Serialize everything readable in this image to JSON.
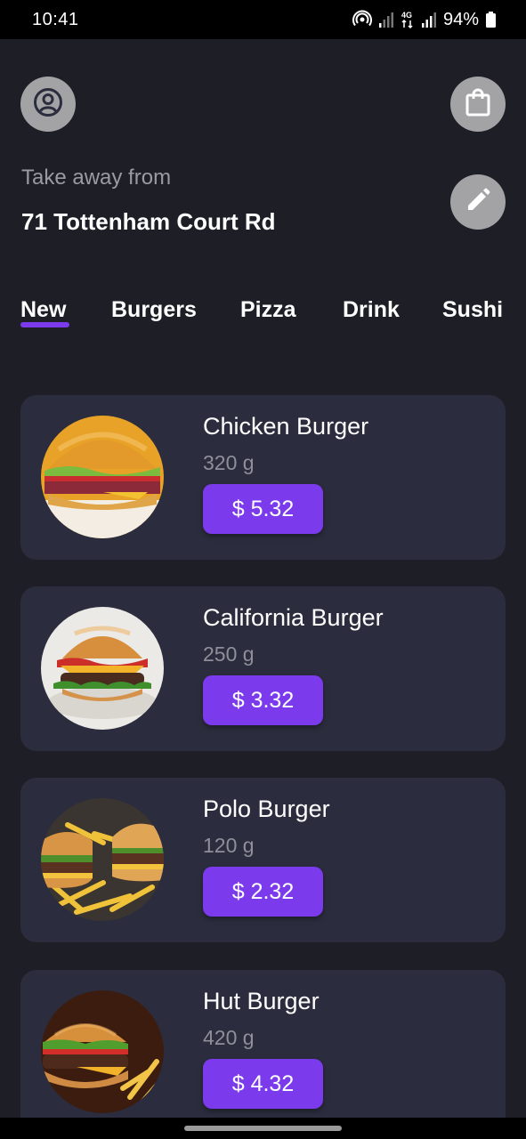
{
  "status_bar": {
    "time": "10:41",
    "network": "4G",
    "battery": "94%",
    "icons": [
      "hotspot-icon",
      "signal-icon",
      "network-4g-icon",
      "signal-icon",
      "battery-icon"
    ]
  },
  "header": {
    "profile_icon": "account-circle-icon",
    "bag_icon": "shopping-bag-icon",
    "edit_icon": "pencil-icon",
    "takeaway_label": "Take away from",
    "address": "71 Tottenham Court Rd"
  },
  "tabs": [
    {
      "label": "New",
      "selected": true
    },
    {
      "label": "Burgers",
      "selected": false
    },
    {
      "label": "Pizza",
      "selected": false
    },
    {
      "label": "Drink",
      "selected": false
    },
    {
      "label": "Sushi",
      "selected": false
    }
  ],
  "products": [
    {
      "name": "Chicken Burger",
      "weight": "320 g",
      "price": "$ 5.32"
    },
    {
      "name": "California Burger",
      "weight": "250 g",
      "price": "$ 3.32"
    },
    {
      "name": "Polo Burger",
      "weight": "120 g",
      "price": "$ 2.32"
    },
    {
      "name": "Hut Burger",
      "weight": "420 g",
      "price": "$ 4.32"
    }
  ],
  "colors": {
    "background": "#1e1f26",
    "card": "#2b2d3e",
    "accent": "#7c3aed",
    "icon_button": "#a3a3a5",
    "muted_text": "#9a9ba2"
  }
}
